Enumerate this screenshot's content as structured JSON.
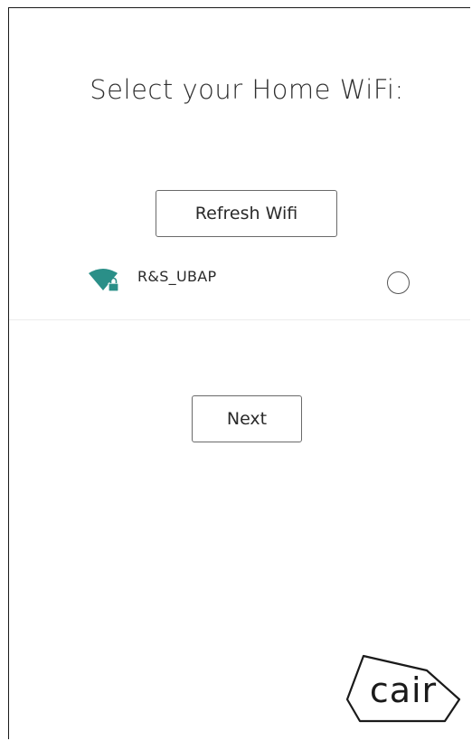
{
  "screen": {
    "title": "Select your Home WiFi:"
  },
  "actions": {
    "refresh_label": "Refresh Wifi",
    "next_label": "Next"
  },
  "networks": [
    {
      "ssid": "R&S_UBAP",
      "icon": "wifi-lock-icon",
      "secured": true,
      "selected": false
    }
  ],
  "brand": {
    "logo_text": "cair",
    "accent_color": "#2a8f88"
  }
}
